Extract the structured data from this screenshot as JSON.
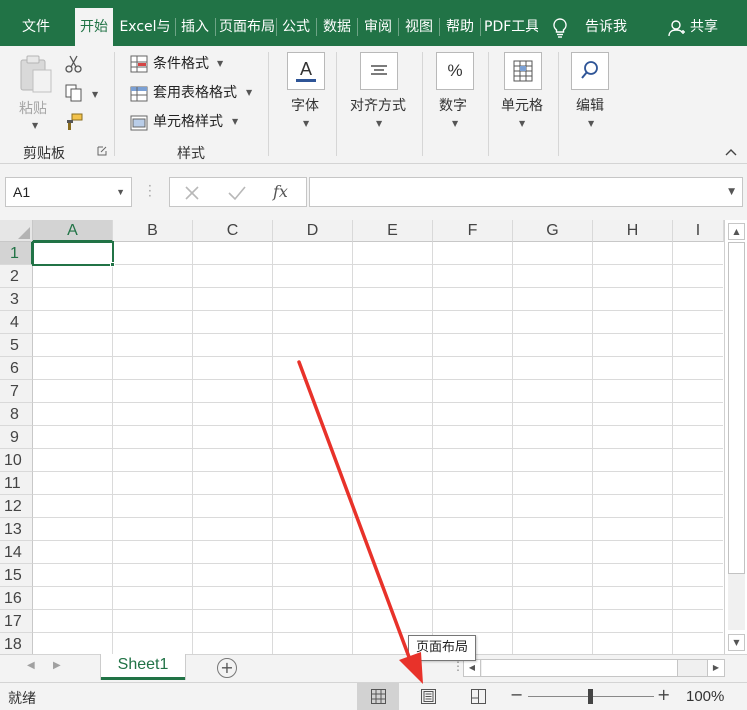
{
  "ribbon_tabs": [
    {
      "label": "文件"
    },
    {
      "label": "开始"
    },
    {
      "label": "Excel与"
    },
    {
      "label": "插入"
    },
    {
      "label": "页面布局"
    },
    {
      "label": "公式"
    },
    {
      "label": "数据"
    },
    {
      "label": "审阅"
    },
    {
      "label": "视图"
    },
    {
      "label": "帮助"
    },
    {
      "label": "PDF工具"
    }
  ],
  "active_tab": "开始",
  "tell_me": "告诉我",
  "share": "共享",
  "clipboard": {
    "paste_label": "粘贴",
    "group_label": "剪贴板"
  },
  "styles": {
    "conditional_format": "条件格式",
    "format_as_table": "套用表格格式",
    "cell_styles": "单元格样式",
    "group_label": "样式"
  },
  "font_label": "字体",
  "alignment_label": "对齐方式",
  "number_label": "数字",
  "cells_label": "单元格",
  "editing_label": "编辑",
  "name_box": "A1",
  "fx_label": "fx",
  "formula_value": "",
  "columns": [
    "A",
    "B",
    "C",
    "D",
    "E",
    "F",
    "G",
    "H",
    "I"
  ],
  "rows": [
    "1",
    "2",
    "3",
    "4",
    "5",
    "6",
    "7",
    "8",
    "9",
    "10",
    "11",
    "12",
    "13",
    "14",
    "15",
    "16",
    "17",
    "18"
  ],
  "selected_cell": {
    "col": "A",
    "row": "1"
  },
  "sheets": [
    {
      "name": "Sheet1",
      "active": true
    }
  ],
  "tooltip": "页面布局",
  "status": "就绪",
  "zoom": "100%",
  "colors": {
    "brand": "#217346",
    "annotation_arrow": "#e8322a"
  }
}
